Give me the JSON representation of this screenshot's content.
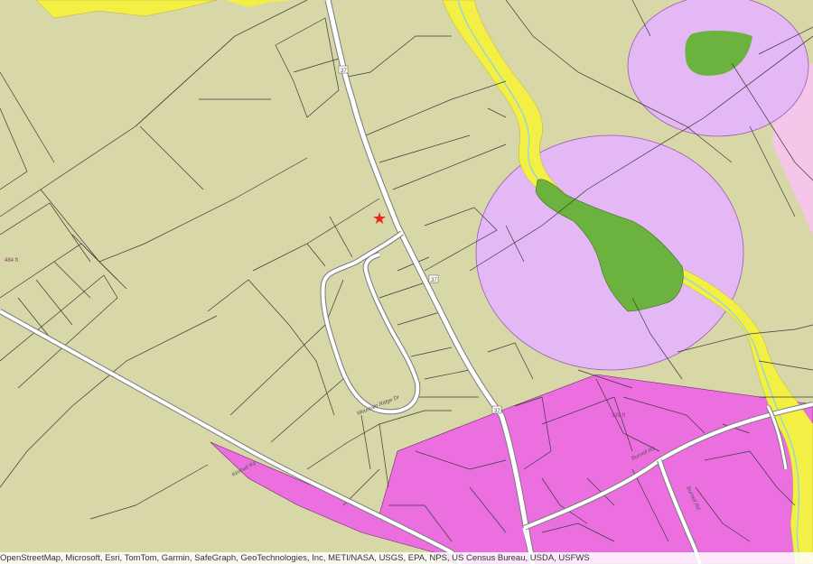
{
  "map": {
    "layers": {
      "base_color": "#d8d7a8",
      "development_color": "#ec6fe0",
      "buffer_color": "#e3b8f4",
      "wetland_color": "#6cb23e",
      "riparian_color": "#f3ef45",
      "road_color": "#ffffff",
      "parcel_line_color": "#3a3a3a"
    },
    "marker": {
      "symbol": "★",
      "color": "#e52b20",
      "name": "location-star"
    },
    "labels": {
      "route_37_a": "37",
      "route_37_b": "37",
      "route_37_c": "37",
      "road_sw": "Kimball Rd",
      "road_loop": "Mountain Ridge Dr",
      "road_east": "Burnell Rd",
      "road_east_b": "Burnell Rd",
      "elev_left": "484 ft",
      "elev_right": "339 ft"
    },
    "attribution": "OpenStreetMap, Microsoft, Esri, TomTom, Garmin, SafeGraph, GeoTechnologies, Inc, METI/NASA, USGS, EPA, NPS, US Census Bureau, USDA, USFWS"
  }
}
